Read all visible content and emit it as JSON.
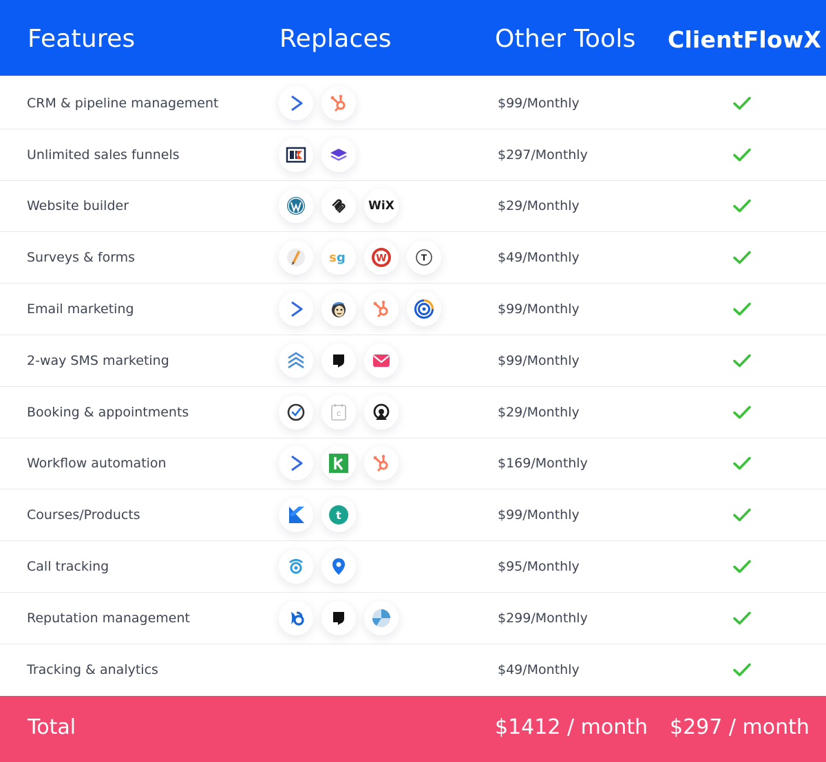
{
  "header": {
    "features": "Features",
    "replaces": "Replaces",
    "other_tools": "Other Tools",
    "brand": "ClientFlowX"
  },
  "rows": [
    {
      "feature": "CRM & pipeline management",
      "price": "$99/Monthly",
      "icons": [
        "activecampaign-icon",
        "hubspot-icon"
      ]
    },
    {
      "feature": "Unlimited sales funnels",
      "price": "$297/Monthly",
      "icons": [
        "clickfunnels-icon",
        "layers-icon"
      ]
    },
    {
      "feature": "Website builder",
      "price": "$29/Monthly",
      "icons": [
        "wordpress-icon",
        "squarespace-icon",
        "wix-icon"
      ]
    },
    {
      "feature": "Surveys & forms",
      "price": "$49/Monthly",
      "icons": [
        "pencil-icon",
        "surveygizmo-icon",
        "wufoo-icon",
        "typeform-icon"
      ]
    },
    {
      "feature": "Email marketing",
      "price": "$99/Monthly",
      "icons": [
        "activecampaign-icon",
        "mailchimp-icon",
        "hubspot-icon",
        "constant-contact-icon"
      ]
    },
    {
      "feature": "2-way SMS marketing",
      "price": "$99/Monthly",
      "icons": [
        "chevrons-up-icon",
        "podium-icon",
        "envelope-icon"
      ]
    },
    {
      "feature": "Booking & appointments",
      "price": "$29/Monthly",
      "icons": [
        "clock-check-icon",
        "calendar-icon",
        "acuity-icon"
      ]
    },
    {
      "feature": "Workflow automation",
      "price": "$169/Monthly",
      "icons": [
        "activecampaign-icon",
        "keap-icon",
        "hubspot-icon"
      ]
    },
    {
      "feature": "Courses/Products",
      "price": "$99/Monthly",
      "icons": [
        "kajabi-icon",
        "teachable-icon"
      ]
    },
    {
      "feature": "Call tracking",
      "price": "$95/Monthly",
      "icons": [
        "callrail-icon",
        "location-pin-icon"
      ]
    },
    {
      "feature": "Reputation management",
      "price": "$299/Monthly",
      "icons": [
        "birdeye-icon",
        "podium-icon",
        "pie-icon"
      ]
    },
    {
      "feature": "Tracking & analytics",
      "price": "$49/Monthly",
      "icons": []
    }
  ],
  "check_color": "#3cc13b",
  "footer": {
    "total": "Total",
    "other_total": "$1412 / month",
    "brand_total": "$297 / month"
  },
  "icon_text": {
    "wix": "WiX",
    "typeform": "T"
  },
  "colors": {
    "header_bg": "#0a5cf5",
    "footer_bg": "#f2476f"
  }
}
